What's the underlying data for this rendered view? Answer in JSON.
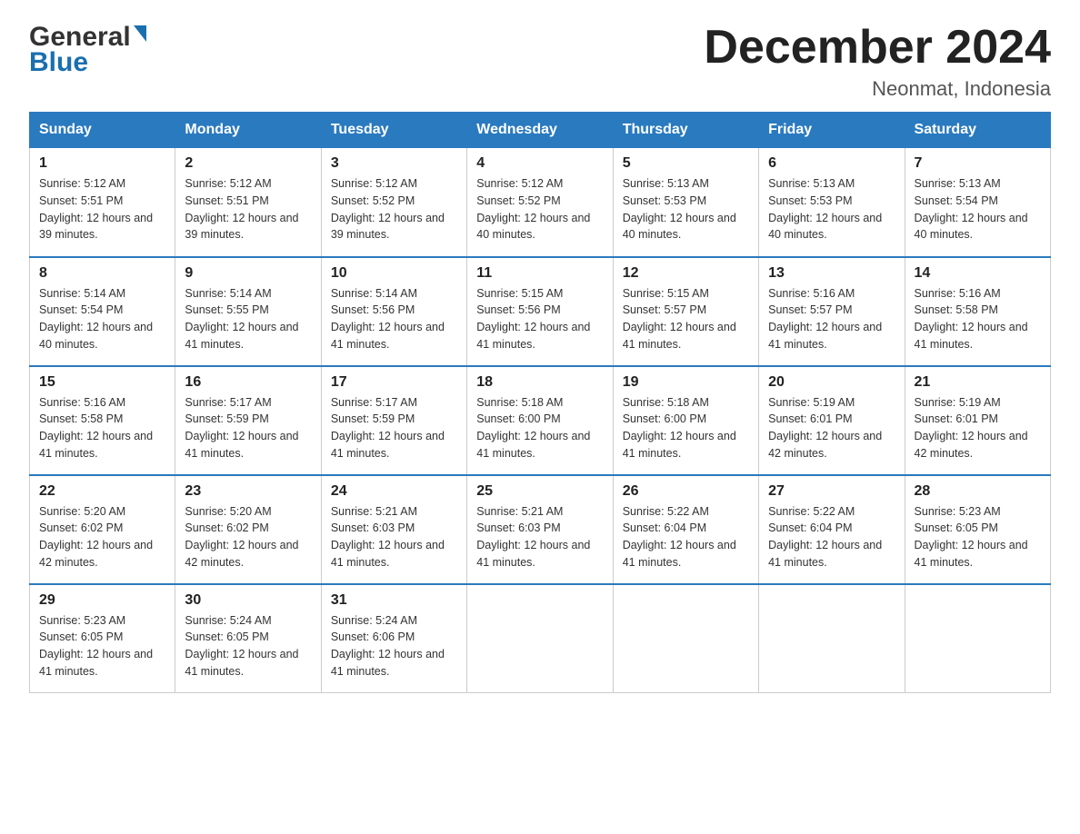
{
  "logo": {
    "general": "General",
    "blue": "Blue",
    "arrow": "▶"
  },
  "title": "December 2024",
  "subtitle": "Neonmat, Indonesia",
  "days_of_week": [
    "Sunday",
    "Monday",
    "Tuesday",
    "Wednesday",
    "Thursday",
    "Friday",
    "Saturday"
  ],
  "weeks": [
    [
      {
        "day": "1",
        "sunrise": "5:12 AM",
        "sunset": "5:51 PM",
        "daylight": "12 hours and 39 minutes."
      },
      {
        "day": "2",
        "sunrise": "5:12 AM",
        "sunset": "5:51 PM",
        "daylight": "12 hours and 39 minutes."
      },
      {
        "day": "3",
        "sunrise": "5:12 AM",
        "sunset": "5:52 PM",
        "daylight": "12 hours and 39 minutes."
      },
      {
        "day": "4",
        "sunrise": "5:12 AM",
        "sunset": "5:52 PM",
        "daylight": "12 hours and 40 minutes."
      },
      {
        "day": "5",
        "sunrise": "5:13 AM",
        "sunset": "5:53 PM",
        "daylight": "12 hours and 40 minutes."
      },
      {
        "day": "6",
        "sunrise": "5:13 AM",
        "sunset": "5:53 PM",
        "daylight": "12 hours and 40 minutes."
      },
      {
        "day": "7",
        "sunrise": "5:13 AM",
        "sunset": "5:54 PM",
        "daylight": "12 hours and 40 minutes."
      }
    ],
    [
      {
        "day": "8",
        "sunrise": "5:14 AM",
        "sunset": "5:54 PM",
        "daylight": "12 hours and 40 minutes."
      },
      {
        "day": "9",
        "sunrise": "5:14 AM",
        "sunset": "5:55 PM",
        "daylight": "12 hours and 41 minutes."
      },
      {
        "day": "10",
        "sunrise": "5:14 AM",
        "sunset": "5:56 PM",
        "daylight": "12 hours and 41 minutes."
      },
      {
        "day": "11",
        "sunrise": "5:15 AM",
        "sunset": "5:56 PM",
        "daylight": "12 hours and 41 minutes."
      },
      {
        "day": "12",
        "sunrise": "5:15 AM",
        "sunset": "5:57 PM",
        "daylight": "12 hours and 41 minutes."
      },
      {
        "day": "13",
        "sunrise": "5:16 AM",
        "sunset": "5:57 PM",
        "daylight": "12 hours and 41 minutes."
      },
      {
        "day": "14",
        "sunrise": "5:16 AM",
        "sunset": "5:58 PM",
        "daylight": "12 hours and 41 minutes."
      }
    ],
    [
      {
        "day": "15",
        "sunrise": "5:16 AM",
        "sunset": "5:58 PM",
        "daylight": "12 hours and 41 minutes."
      },
      {
        "day": "16",
        "sunrise": "5:17 AM",
        "sunset": "5:59 PM",
        "daylight": "12 hours and 41 minutes."
      },
      {
        "day": "17",
        "sunrise": "5:17 AM",
        "sunset": "5:59 PM",
        "daylight": "12 hours and 41 minutes."
      },
      {
        "day": "18",
        "sunrise": "5:18 AM",
        "sunset": "6:00 PM",
        "daylight": "12 hours and 41 minutes."
      },
      {
        "day": "19",
        "sunrise": "5:18 AM",
        "sunset": "6:00 PM",
        "daylight": "12 hours and 41 minutes."
      },
      {
        "day": "20",
        "sunrise": "5:19 AM",
        "sunset": "6:01 PM",
        "daylight": "12 hours and 42 minutes."
      },
      {
        "day": "21",
        "sunrise": "5:19 AM",
        "sunset": "6:01 PM",
        "daylight": "12 hours and 42 minutes."
      }
    ],
    [
      {
        "day": "22",
        "sunrise": "5:20 AM",
        "sunset": "6:02 PM",
        "daylight": "12 hours and 42 minutes."
      },
      {
        "day": "23",
        "sunrise": "5:20 AM",
        "sunset": "6:02 PM",
        "daylight": "12 hours and 42 minutes."
      },
      {
        "day": "24",
        "sunrise": "5:21 AM",
        "sunset": "6:03 PM",
        "daylight": "12 hours and 41 minutes."
      },
      {
        "day": "25",
        "sunrise": "5:21 AM",
        "sunset": "6:03 PM",
        "daylight": "12 hours and 41 minutes."
      },
      {
        "day": "26",
        "sunrise": "5:22 AM",
        "sunset": "6:04 PM",
        "daylight": "12 hours and 41 minutes."
      },
      {
        "day": "27",
        "sunrise": "5:22 AM",
        "sunset": "6:04 PM",
        "daylight": "12 hours and 41 minutes."
      },
      {
        "day": "28",
        "sunrise": "5:23 AM",
        "sunset": "6:05 PM",
        "daylight": "12 hours and 41 minutes."
      }
    ],
    [
      {
        "day": "29",
        "sunrise": "5:23 AM",
        "sunset": "6:05 PM",
        "daylight": "12 hours and 41 minutes."
      },
      {
        "day": "30",
        "sunrise": "5:24 AM",
        "sunset": "6:05 PM",
        "daylight": "12 hours and 41 minutes."
      },
      {
        "day": "31",
        "sunrise": "5:24 AM",
        "sunset": "6:06 PM",
        "daylight": "12 hours and 41 minutes."
      },
      null,
      null,
      null,
      null
    ]
  ]
}
